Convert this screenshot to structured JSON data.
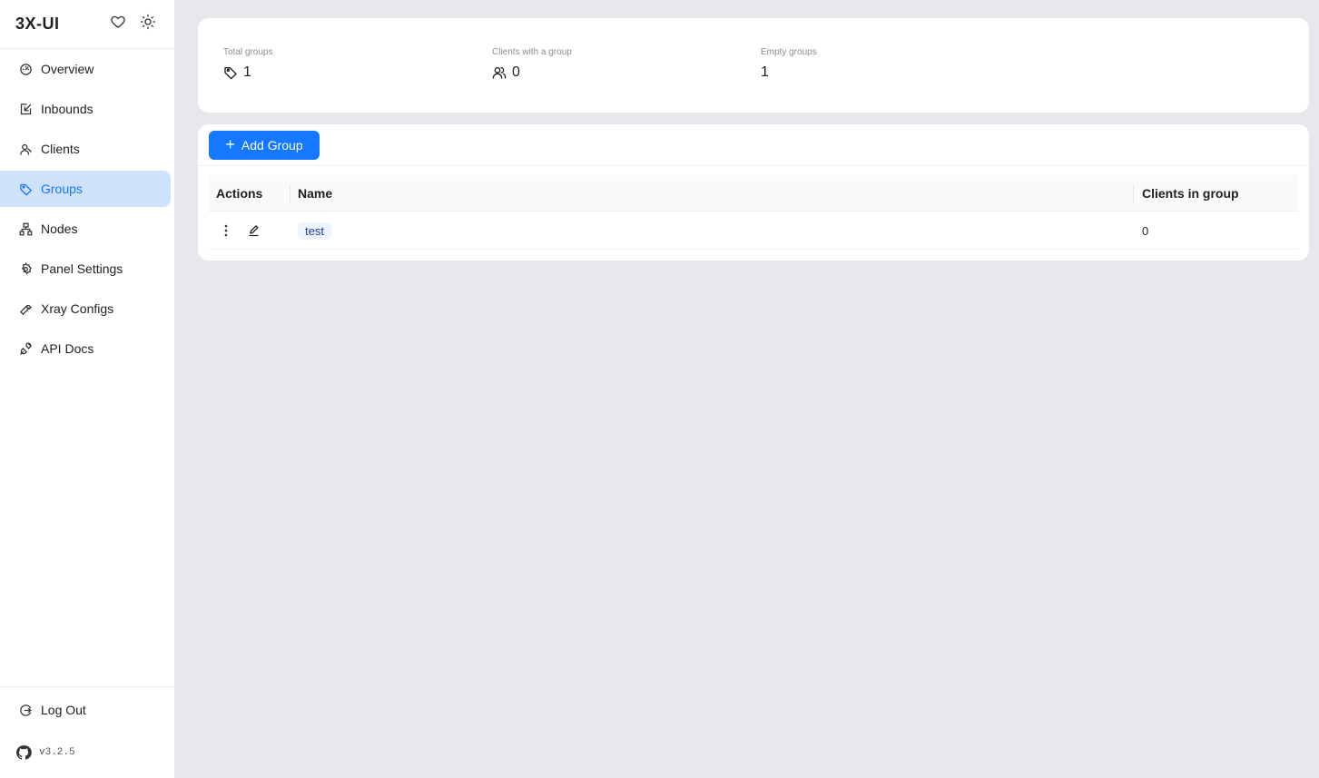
{
  "app": {
    "title": "3X-UI",
    "version": "v3.2.5"
  },
  "header_icons": [
    "heart-icon",
    "sun-icon"
  ],
  "sidebar": {
    "items": [
      {
        "label": "Overview",
        "icon": "dashboard-icon",
        "active": false
      },
      {
        "label": "Inbounds",
        "icon": "inbound-icon",
        "active": false
      },
      {
        "label": "Clients",
        "icon": "user-icon",
        "active": false
      },
      {
        "label": "Groups",
        "icon": "tag-icon",
        "active": true
      },
      {
        "label": "Nodes",
        "icon": "cluster-icon",
        "active": false
      },
      {
        "label": "Panel Settings",
        "icon": "gear-icon",
        "active": false
      },
      {
        "label": "Xray Configs",
        "icon": "tool-icon",
        "active": false
      },
      {
        "label": "API Docs",
        "icon": "api-icon",
        "active": false
      }
    ],
    "logout_label": "Log Out"
  },
  "stats": {
    "total_groups": {
      "label": "Total groups",
      "value": "1"
    },
    "clients_with_group": {
      "label": "Clients with a group",
      "value": "0"
    },
    "empty_groups": {
      "label": "Empty groups",
      "value": "1"
    }
  },
  "toolbar": {
    "add_label": "Add Group"
  },
  "table": {
    "columns": [
      "Actions",
      "Name",
      "Clients in group"
    ],
    "rows": [
      {
        "name": "test",
        "clients": "0"
      }
    ]
  },
  "colors": {
    "primary": "#1677ff",
    "active_bg": "#cfe2fc",
    "page_bg": "#e6e8ec",
    "tag_bg": "#eef4ff"
  }
}
